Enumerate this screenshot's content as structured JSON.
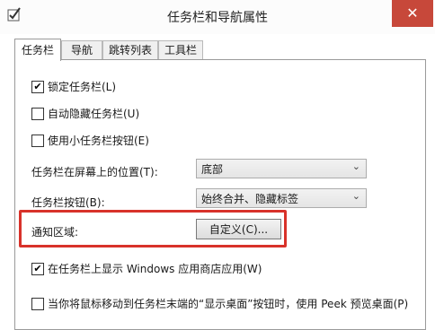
{
  "window": {
    "title": "任务栏和导航属性",
    "close_glyph": "✕"
  },
  "tabs": [
    {
      "label": "任务栏",
      "active": true
    },
    {
      "label": "导航",
      "active": false
    },
    {
      "label": "跳转列表",
      "active": false
    },
    {
      "label": "工具栏",
      "active": false
    }
  ],
  "options": {
    "lock_taskbar": {
      "label": "锁定任务栏(L)",
      "checked": true
    },
    "auto_hide": {
      "label": "自动隐藏任务栏(U)",
      "checked": false
    },
    "small_buttons": {
      "label": "使用小任务栏按钮(E)",
      "checked": false
    },
    "show_store_apps": {
      "label": "在任务栏上显示 Windows 应用商店应用(W)",
      "checked": true
    },
    "peek_preview": {
      "label": "当你将鼠标移动到任务栏末端的“显示桌面”按钮时，使用 Peek 预览桌面(P)",
      "checked": false
    }
  },
  "location": {
    "label": "任务栏在屏幕上的位置(T):",
    "value": "底部"
  },
  "buttons_combine": {
    "label": "任务栏按钮(B):",
    "value": "始终合并、隐藏标签"
  },
  "notification": {
    "label": "通知区域:",
    "button_label": "自定义(C)..."
  },
  "colors": {
    "highlight": "#d8322a",
    "close": "#c7483a"
  },
  "icons": {
    "check": "✔",
    "chevron": "⌄"
  }
}
